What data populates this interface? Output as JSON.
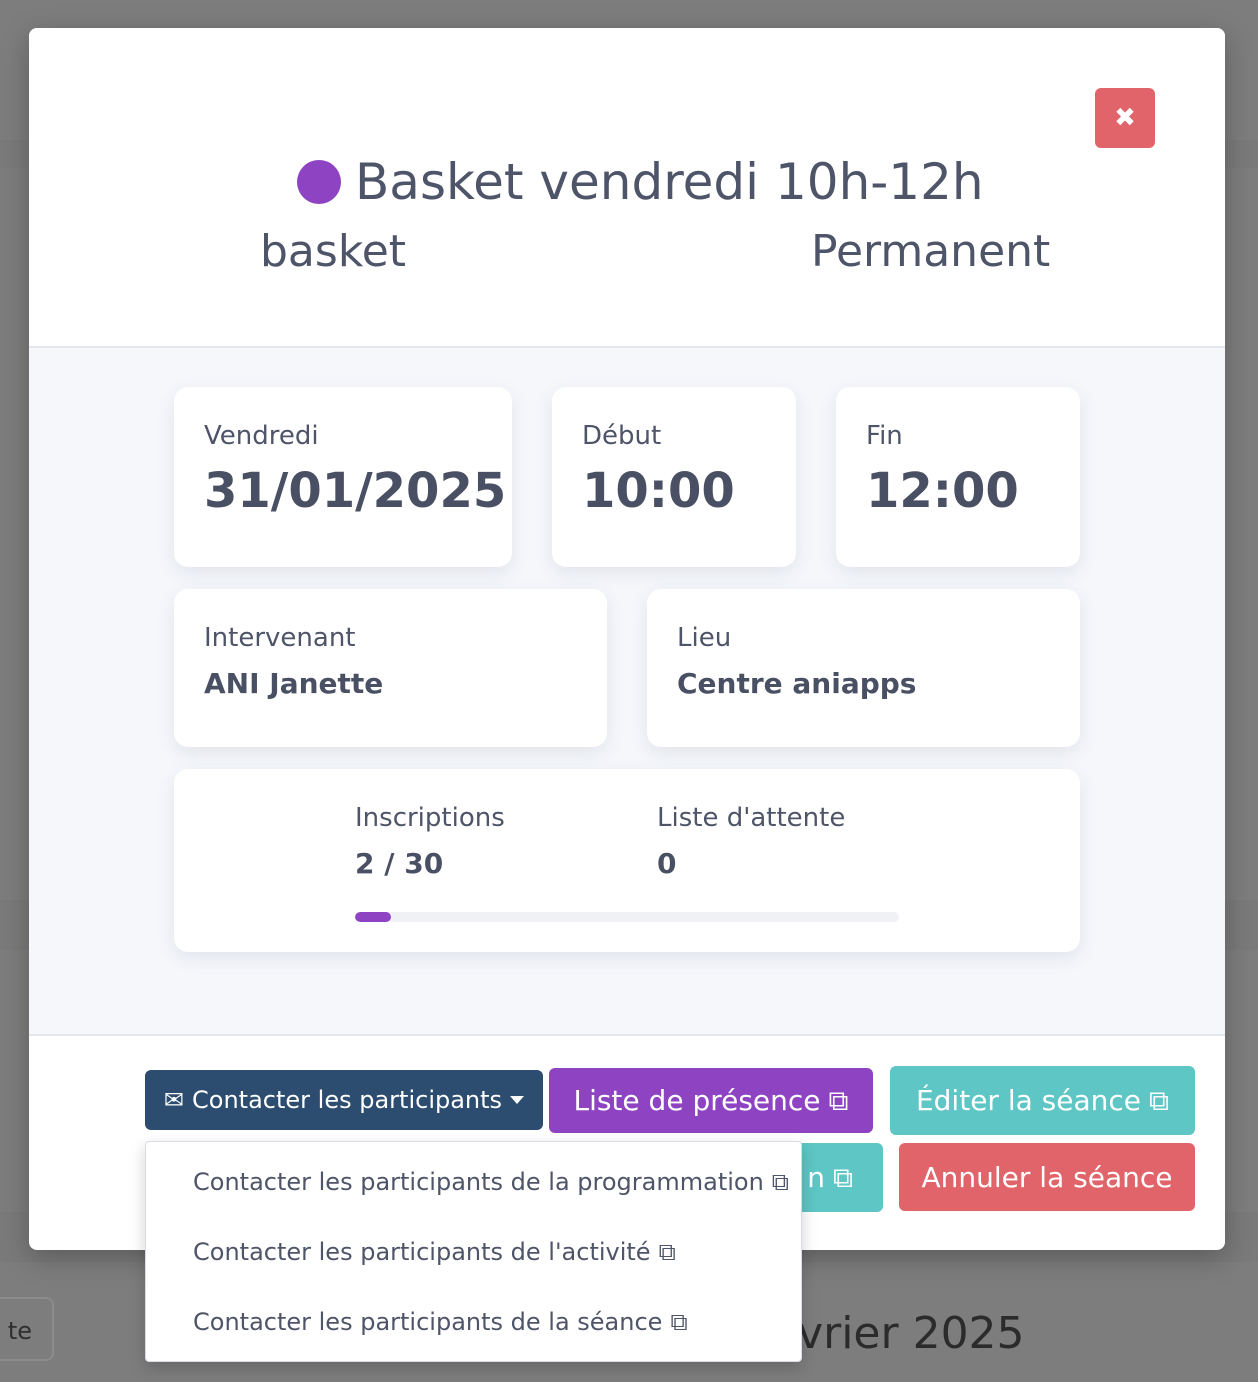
{
  "background": {
    "button_label": "te",
    "month_label": "évrier 2025"
  },
  "modal": {
    "title": "Basket vendredi 10h-12h",
    "activity": "basket",
    "type": "Permanent",
    "accent_color": "#8e44c2",
    "close_icon": "times-icon"
  },
  "cards": {
    "day": {
      "label": "Vendredi",
      "value": "31/01/2025"
    },
    "start": {
      "label": "Début",
      "value": "10:00"
    },
    "end": {
      "label": "Fin",
      "value": "12:00"
    },
    "instructor": {
      "label": "Intervenant",
      "value": "ANI Janette"
    },
    "place": {
      "label": "Lieu",
      "value": "Centre aniapps"
    },
    "registrations": {
      "label": "Inscriptions",
      "value": "2 / 30",
      "progress": 0.0667
    },
    "waitlist": {
      "label": "Liste d'attente",
      "value": "0"
    }
  },
  "footer": {
    "contact_label": "Contacter les participants",
    "attendance_label": "Liste de présence",
    "edit_label": "Éditer la séance",
    "hidden_label_tail": "n",
    "cancel_label": "Annuler la séance"
  },
  "dropdown": {
    "items": [
      "Contacter les participants de la programmation",
      "Contacter les participants de l'activité",
      "Contacter les participants de la séance"
    ]
  },
  "colors": {
    "danger": "#e06469",
    "primary_dark": "#2d4d70",
    "purple": "#8e44c2",
    "teal": "#5ec6c5"
  }
}
